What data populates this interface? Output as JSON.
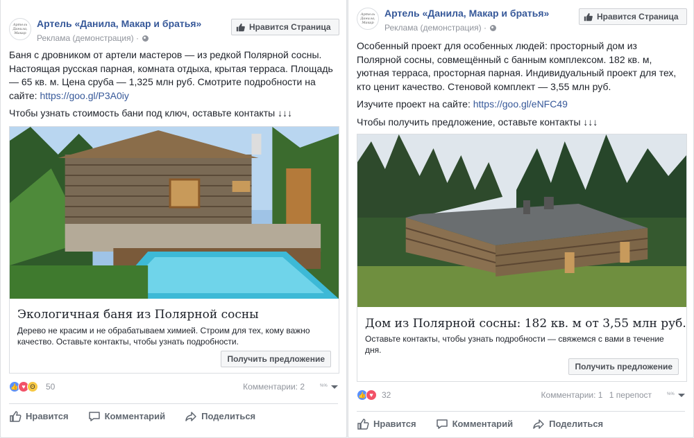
{
  "posts": [
    {
      "page_name": "Артель «Данила, Макар и братья»",
      "avatar_text": "Артель «Данила, Макар и братья»",
      "sponsored_label": "Реклама (демонстрация) ·",
      "like_page_label": "Нравится Страница",
      "text_lines": [
        "Баня с дровником от артели мастеров — из редкой Полярной сосны. Настоящая русская парная, комната отдыха, крытая терраса. Площадь — 65 кв. м. Цена сруба — 1,325 млн руб. Смотрите подробности на сайте:"
      ],
      "link": "https://goo.gl/P3A0iy",
      "text_cta": "Чтобы узнать стоимость бани под ключ, оставьте контакты ↓↓↓",
      "ad_title": "Экологичная баня из Полярной сосны",
      "ad_desc": "Дерево не красим и не обрабатываем химией. Строим для тех, кому важно качество. Оставьте контакты, чтобы узнать подробности.",
      "cta_label": "Получить предложение",
      "reaction_count": "50",
      "comments": "Комментарии: 2",
      "shares": "",
      "actions": {
        "like": "Нравится",
        "comment": "Комментарий",
        "share": "Поделиться"
      }
    },
    {
      "page_name": "Артель «Данила, Макар и братья»",
      "avatar_text": "Артель «Данила, Макар и братья»",
      "sponsored_label": "Реклама (демонстрация) ·",
      "like_page_label": "Нравится Страница",
      "text_lines": [
        "Особенный проект для особенных людей: просторный дом из Полярной сосны, совмещённый с банным комплексом. 182 кв. м, уютная терраса, просторная парная. Индивидуальный проект для тех, кто ценит качество. Стеновой комплект — 3,55 млн руб."
      ],
      "link_prefix": "Изучите проект на сайте:",
      "link": "https://goo.gl/eNFC49",
      "text_cta": "Чтобы получить предложение, оставьте контакты ↓↓↓",
      "ad_title": "Дом из Полярной сосны: 182 кв. м от 3,55 млн руб.",
      "ad_desc": "Оставьте контакты, чтобы узнать подробности — свяжемся с вами в течение дня.",
      "cta_label": "Получить предложение",
      "reaction_count": "32",
      "comments": "Комментарии: 1",
      "shares": "1 перепост",
      "actions": {
        "like": "Нравится",
        "comment": "Комментарий",
        "share": "Поделиться"
      }
    }
  ],
  "colors": {
    "link": "#365899",
    "like": "#5890ff",
    "love": "#f25268",
    "wow": "#f7c843"
  }
}
